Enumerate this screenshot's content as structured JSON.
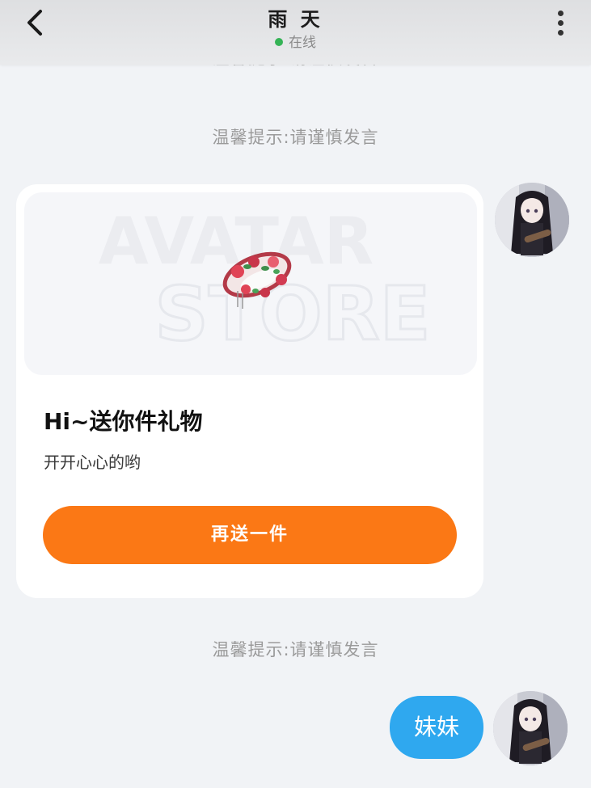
{
  "header": {
    "title": "雨 天",
    "status": "在线",
    "back_icon": "chevron-left-icon",
    "more_icon": "more-vertical-icon"
  },
  "notices": {
    "partial_top": "温馨提示:请谨慎发言",
    "notice_1": "温馨提示:请谨慎发言",
    "notice_2": "温馨提示:请谨慎发言"
  },
  "gift_card": {
    "watermark_line1": "AVATAR",
    "watermark_line2": "STORE",
    "title": "Hi~送你件礼物",
    "subtitle": "开开心心的哟",
    "button_label": "再送一件"
  },
  "messages": [
    {
      "text": "妹妹"
    }
  ],
  "colors": {
    "accent_orange": "#fb7815",
    "bubble_blue": "#2fa8ef",
    "online_green": "#35b356",
    "background": "#f1f3f6"
  }
}
